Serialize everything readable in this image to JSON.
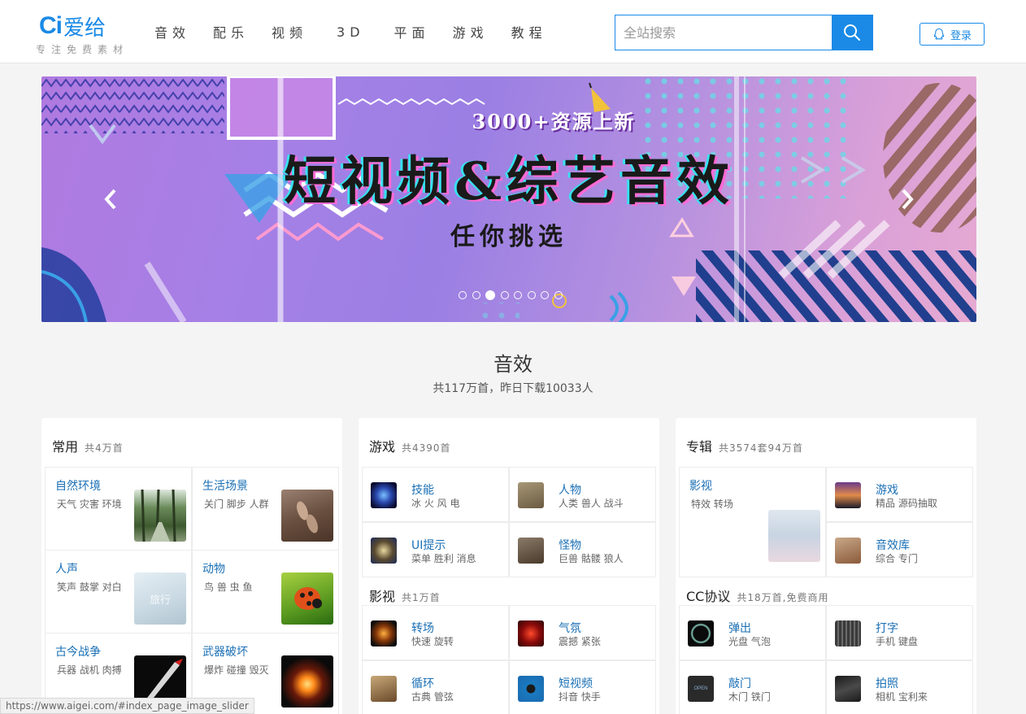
{
  "header": {
    "logo_mark": "Ci",
    "logo_name": "爱给",
    "slogan": "专注免费素材",
    "nav": [
      "音效",
      "配乐",
      "视频",
      "3D",
      "平面",
      "游戏",
      "教程"
    ],
    "search_placeholder": "全站搜索",
    "login_label": "登录"
  },
  "banner": {
    "title_top": "3000+资源上新",
    "title": "短视频&综艺音效",
    "subtitle": "任你挑选",
    "dot_count": 8,
    "active_dot": 3
  },
  "section": {
    "title": "音效",
    "subtitle": "共117万首，昨日下载10033人"
  },
  "cards": {
    "common": {
      "name": "常用",
      "count": "共4万首",
      "items": [
        {
          "title": "自然环境",
          "tags": "天气 灾害 环境"
        },
        {
          "title": "生活场景",
          "tags": "关门 脚步 人群"
        },
        {
          "title": "人声",
          "tags": "笑声 鼓掌 对白"
        },
        {
          "title": "动物",
          "tags": "鸟 兽 虫 鱼"
        },
        {
          "title": "古今战争",
          "tags": "兵器 战机 肉搏"
        },
        {
          "title": "武器破坏",
          "tags": "爆炸 碰撞 毁灭"
        }
      ],
      "watermark": "旅行"
    },
    "game": {
      "name": "游戏",
      "count": "共4390首",
      "items": [
        {
          "title": "技能",
          "tags": "冰 火 风 电"
        },
        {
          "title": "人物",
          "tags": "人类 兽人 战斗"
        },
        {
          "title": "UI提示",
          "tags": "菜单 胜利 消息"
        },
        {
          "title": "怪物",
          "tags": "巨兽 骷髅 狼人"
        }
      ]
    },
    "film": {
      "name": "影视",
      "count": "共1万首",
      "items": [
        {
          "title": "转场",
          "tags": "快速 旋转"
        },
        {
          "title": "气氛",
          "tags": "震撼 紧张"
        },
        {
          "title": "循环",
          "tags": "古典 管弦"
        },
        {
          "title": "短视频",
          "tags": "抖音 快手"
        }
      ]
    },
    "album": {
      "name": "专辑",
      "count": "共3574套94万首",
      "big": {
        "title": "影视",
        "tags": "特效 转场"
      },
      "items": [
        {
          "title": "游戏",
          "tags": "精品 源码抽取"
        },
        {
          "title": "音效库",
          "tags": "综合 专门"
        }
      ]
    },
    "cc": {
      "name": "CC协议",
      "count": "共18万首,免费商用",
      "items": [
        {
          "title": "弹出",
          "tags": "光盘 气泡"
        },
        {
          "title": "打字",
          "tags": "手机 键盘"
        },
        {
          "title": "敲门",
          "tags": "木门 铁门"
        },
        {
          "title": "拍照",
          "tags": "相机 宝利来"
        }
      ],
      "icon_text": "OPEN"
    }
  },
  "status_url": "https://www.aigei.com/#index_page_image_slider"
}
